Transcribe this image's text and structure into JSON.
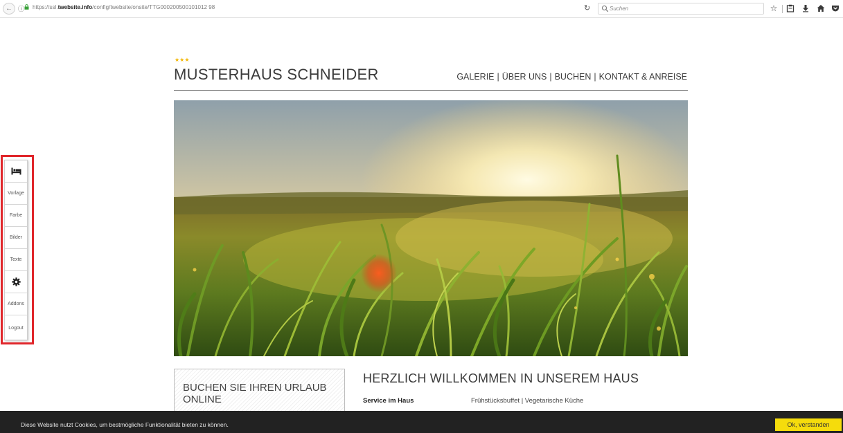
{
  "browser": {
    "url_prefix": "https://ssl.",
    "url_domain": "twebsite.info",
    "url_path": "/config/twebsite/onsite/TTG000200500101012 98",
    "search_placeholder": "Suchen"
  },
  "side_toolbar": {
    "items": [
      {
        "label": "",
        "icon": "bed-icon"
      },
      {
        "label": "Vorlage"
      },
      {
        "label": "Farbe"
      },
      {
        "label": "Bilder"
      },
      {
        "label": "Texte"
      },
      {
        "label": "",
        "icon": "gear-icon"
      },
      {
        "label": "Addons"
      },
      {
        "label": "Logout"
      }
    ]
  },
  "header": {
    "stars": "★★★",
    "title": "MUSTERHAUS SCHNEIDER",
    "nav": [
      "GALERIE",
      "ÜBER UNS",
      "BUCHEN",
      "KONTAKT & ANREISE"
    ]
  },
  "booking": {
    "title": "BUCHEN SIE IHREN URLAUB ONLINE"
  },
  "welcome": {
    "title": "HERZLICH WILLKOMMEN IN UNSEREM HAUS",
    "service_label": "Service im Haus",
    "service_value": "Frühstücksbuffet | Vegetarische Küche"
  },
  "cookie": {
    "text": "Diese Website nutzt Cookies, um bestmögliche Funktionalität bieten zu können.",
    "button": "Ok, verstanden"
  },
  "colors": {
    "highlight": "#e0262b",
    "star": "#f2b705",
    "cookie_bar": "#222222",
    "cookie_button": "#f5dc0c"
  }
}
